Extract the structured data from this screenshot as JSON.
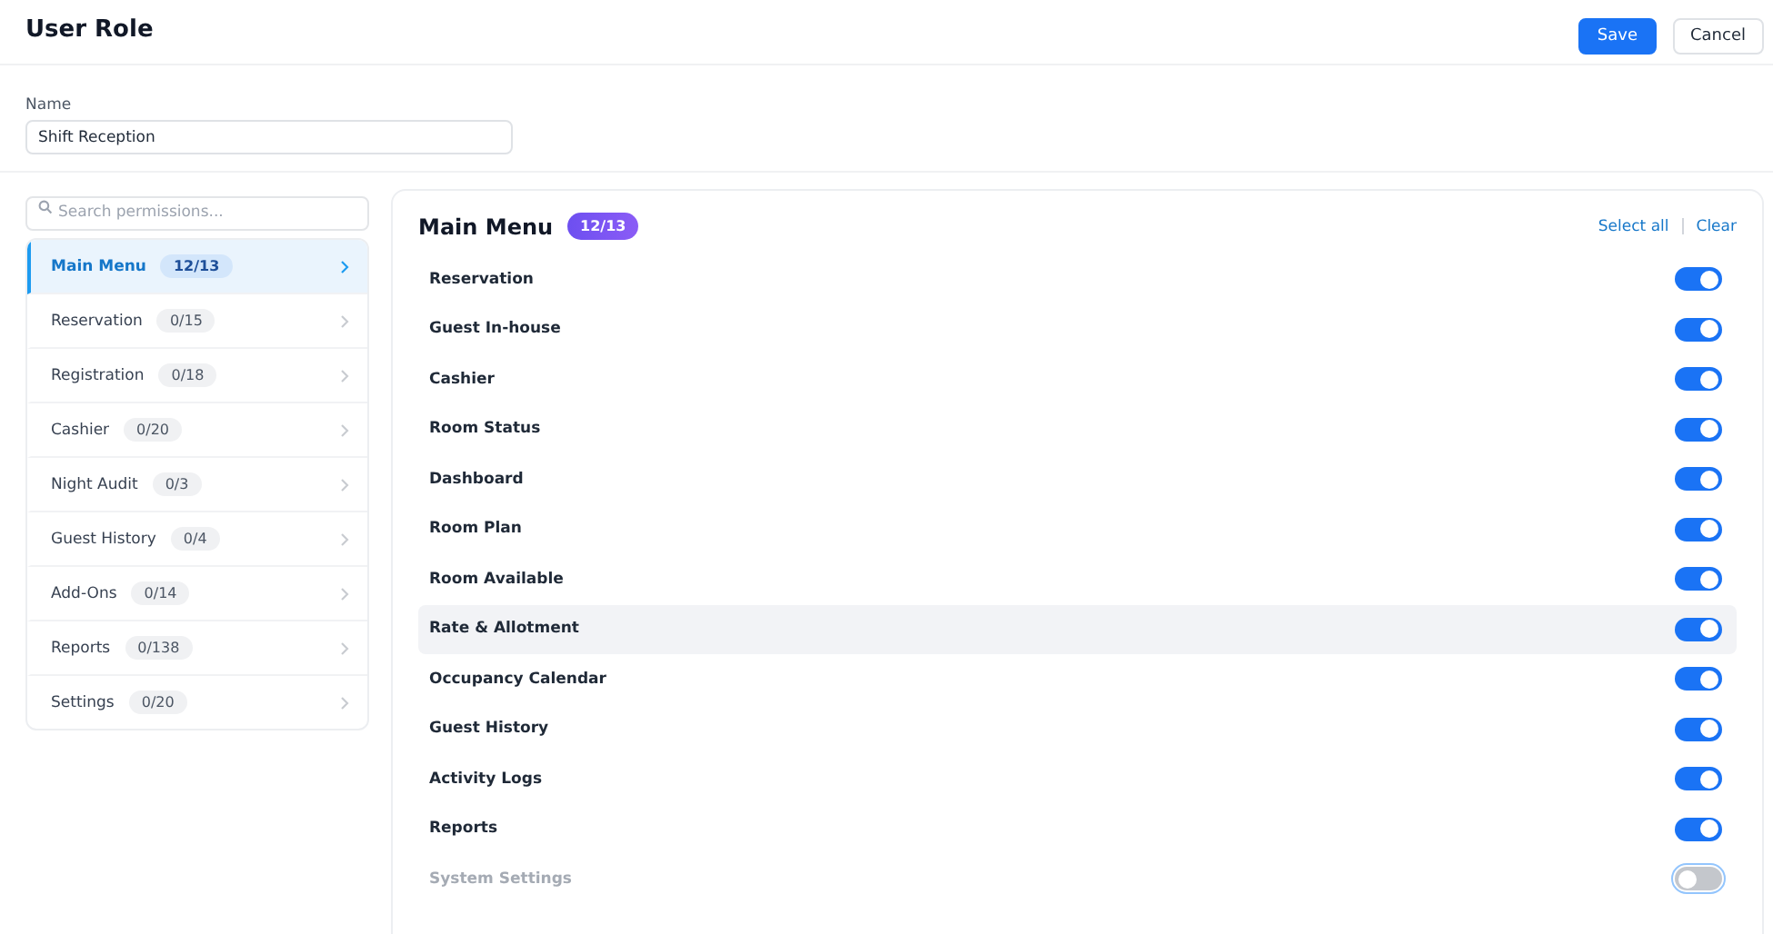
{
  "header": {
    "title": "User Role",
    "buttons": [
      {
        "label": "Save",
        "kind": "primary"
      },
      {
        "label": "Cancel",
        "kind": "secondary"
      }
    ]
  },
  "name_field": {
    "label": "Name",
    "value": "Shift Reception"
  },
  "search": {
    "placeholder": "Search permissions..."
  },
  "sidebar": {
    "items": [
      {
        "label": "Main Menu",
        "count": "12/13",
        "selected": true
      },
      {
        "label": "Reservation",
        "count": "0/15",
        "selected": false
      },
      {
        "label": "Registration",
        "count": "0/18",
        "selected": false
      },
      {
        "label": "Cashier",
        "count": "0/20",
        "selected": false
      },
      {
        "label": "Night Audit",
        "count": "0/3",
        "selected": false
      },
      {
        "label": "Guest History",
        "count": "0/4",
        "selected": false
      },
      {
        "label": "Add-Ons",
        "count": "0/14",
        "selected": false
      },
      {
        "label": "Reports",
        "count": "0/138",
        "selected": false
      },
      {
        "label": "Settings",
        "count": "0/20",
        "selected": false
      }
    ]
  },
  "panel": {
    "title": "Main Menu",
    "count": "12/13",
    "actions": [
      "Select all",
      "Clear"
    ],
    "permissions": [
      {
        "label": "Reservation",
        "on": true,
        "highlighted": false,
        "focused": false
      },
      {
        "label": "Guest In-house",
        "on": true,
        "highlighted": false,
        "focused": false
      },
      {
        "label": "Cashier",
        "on": true,
        "highlighted": false,
        "focused": false
      },
      {
        "label": "Room Status",
        "on": true,
        "highlighted": false,
        "focused": false
      },
      {
        "label": "Dashboard",
        "on": true,
        "highlighted": false,
        "focused": false
      },
      {
        "label": "Room Plan",
        "on": true,
        "highlighted": false,
        "focused": false
      },
      {
        "label": "Room Available",
        "on": true,
        "highlighted": false,
        "focused": false
      },
      {
        "label": "Rate & Allotment",
        "on": true,
        "highlighted": true,
        "focused": false
      },
      {
        "label": "Occupancy Calendar",
        "on": true,
        "highlighted": false,
        "focused": false
      },
      {
        "label": "Guest History",
        "on": true,
        "highlighted": false,
        "focused": false
      },
      {
        "label": "Activity Logs",
        "on": true,
        "highlighted": false,
        "focused": false
      },
      {
        "label": "Reports",
        "on": true,
        "highlighted": false,
        "focused": false
      },
      {
        "label": "System Settings",
        "on": false,
        "highlighted": false,
        "focused": true
      }
    ]
  }
}
